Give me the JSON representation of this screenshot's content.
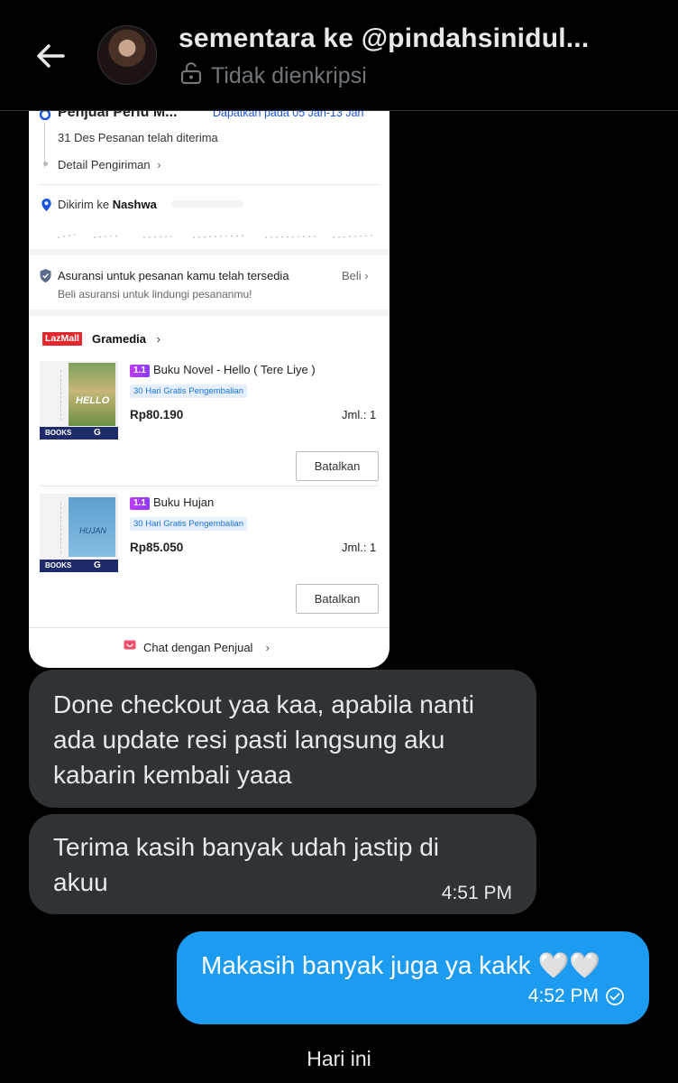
{
  "header": {
    "title": "sementara ke @pindahsinidul...",
    "subtitle": "Tidak dienkripsi"
  },
  "card": {
    "seller_status": "Penjual Perlu M...",
    "delivery_estimate": "Dapatkan pada 05 Jan-13 Jan",
    "order_received": "31 Des Pesanan telah diterima",
    "shipping_detail": "Detail Pengiriman",
    "ship_to_prefix": "Dikirim ke",
    "ship_to_name": "Nashwa",
    "insurance_title": "Asuransi untuk pesanan kamu telah tersedia",
    "insurance_buy": "Beli",
    "insurance_sub": "Beli asuransi untuk lindungi pesananmu!",
    "lazmall_label": "LazMall",
    "store_name": "Gramedia",
    "items": [
      {
        "title": "Buku Novel - Hello ( Tere Liye )",
        "badge": "30 Hari Gratis Pengembalian",
        "price": "Rp80.190",
        "qty": "Jml.: 1",
        "cancel": "Batalkan",
        "cover_text": "HELLO",
        "band": "BOOKS"
      },
      {
        "title": "Buku Hujan",
        "badge": "30 Hari Gratis Pengembalian",
        "price": "Rp85.050",
        "qty": "Jml.: 1",
        "cancel": "Batalkan",
        "cover_text": "HUJAN",
        "band": "BOOKS"
      }
    ],
    "chat_seller": "Chat dengan Penjual"
  },
  "messages": [
    {
      "text": "Done checkout yaa kaa, apabila nanti ada update resi pasti langsung aku kabarin kembali yaaa"
    },
    {
      "text": "Terima kasih banyak udah jastip di akuu",
      "time": "4:51 PM"
    },
    {
      "text": "Makasih banyak juga ya kakk 🤍🤍",
      "time": "4:52 PM"
    }
  ],
  "day_header": "Hari ini",
  "colors": {
    "accent": "#1d9bf0",
    "bubble_in": "#2f3336",
    "lazmall_red": "#e4262d"
  }
}
